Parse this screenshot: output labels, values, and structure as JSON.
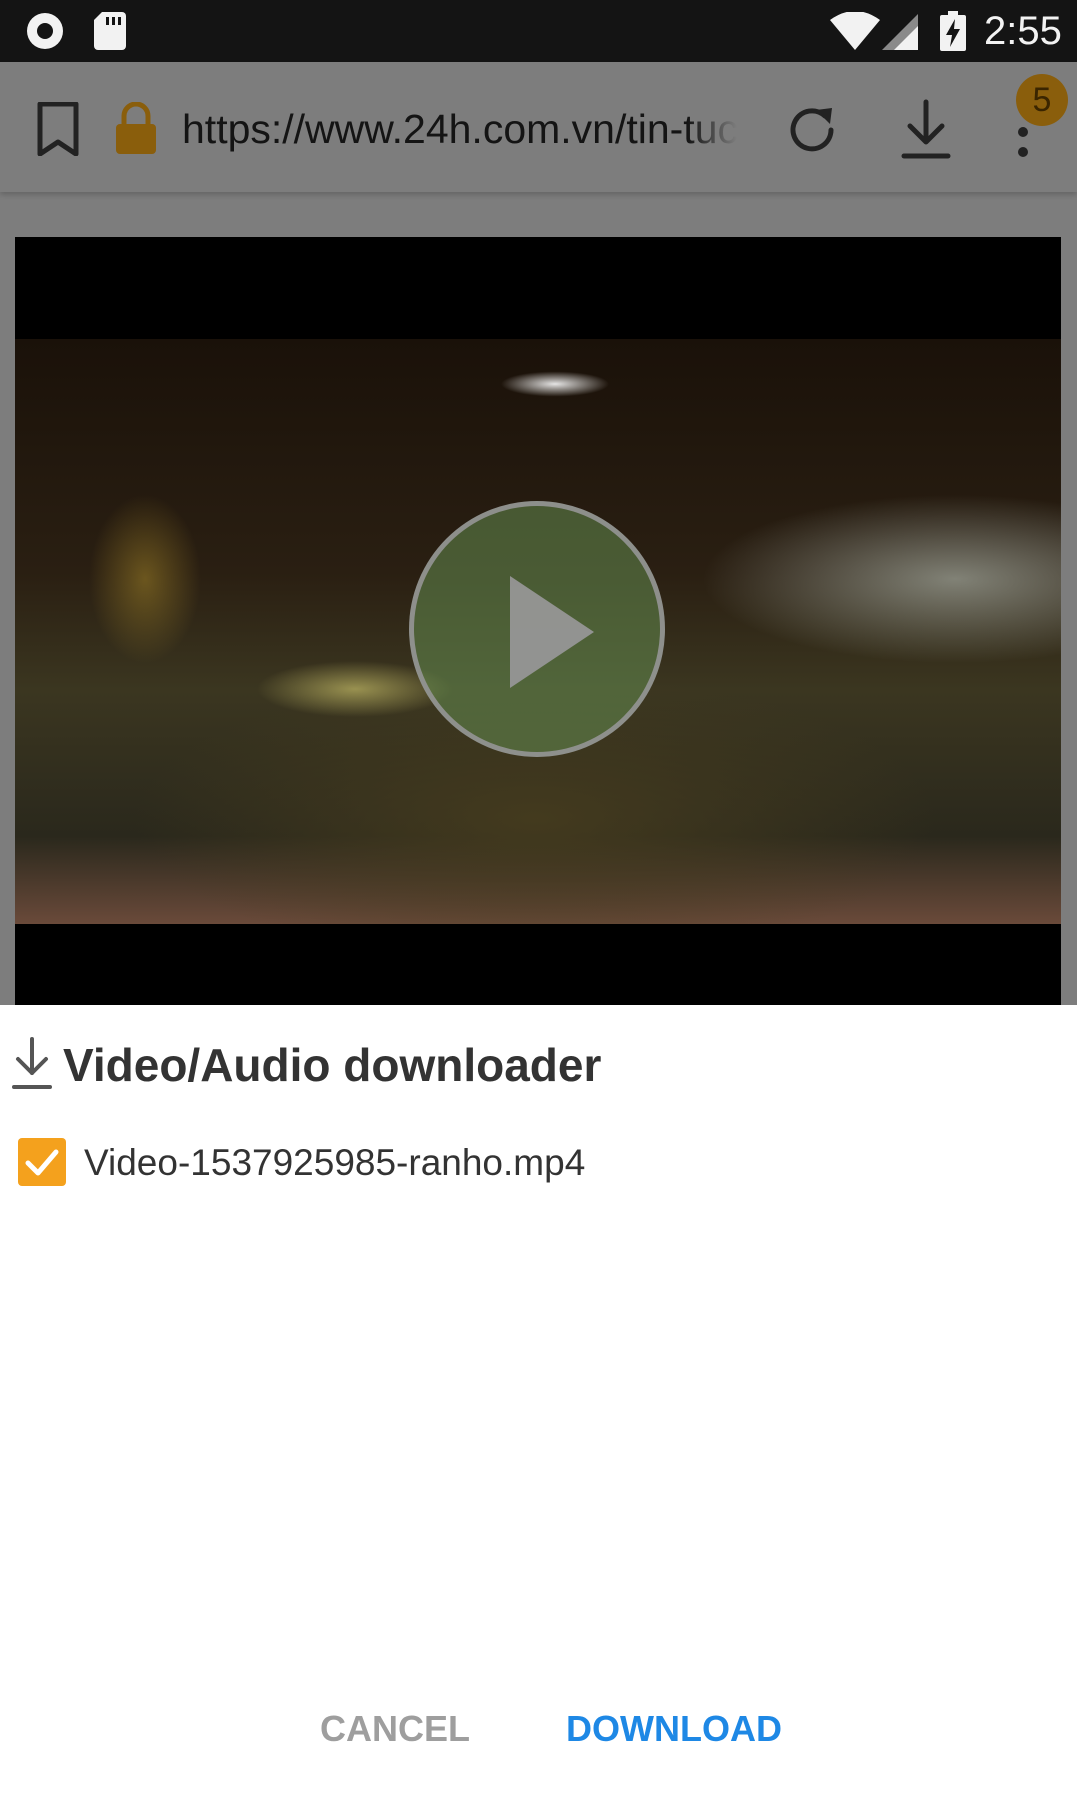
{
  "status_bar": {
    "time": "2:55",
    "icons": [
      "record-icon",
      "sd-card-icon",
      "wifi-icon",
      "cell-signal-icon",
      "battery-charging-icon"
    ]
  },
  "browser": {
    "url": "https://www.24h.com.vn/tin-tuc-",
    "tab_count": "5",
    "icons": [
      "bookmark-icon",
      "lock-icon",
      "reload-icon",
      "download-icon",
      "overflow-menu-icon"
    ],
    "accent_color": "#f4a11d"
  },
  "video": {
    "icons": [
      "play-icon"
    ]
  },
  "dialog": {
    "title": "Video/Audio downloader",
    "items": [
      {
        "name": "Video-1537925985-ranho.mp4",
        "checked": true
      }
    ],
    "cancel_label": "CANCEL",
    "download_label": "DOWNLOAD",
    "colors": {
      "checkbox": "#f4a11d",
      "primary_button": "#1e88e5",
      "secondary_button": "#9e9e9e"
    }
  }
}
